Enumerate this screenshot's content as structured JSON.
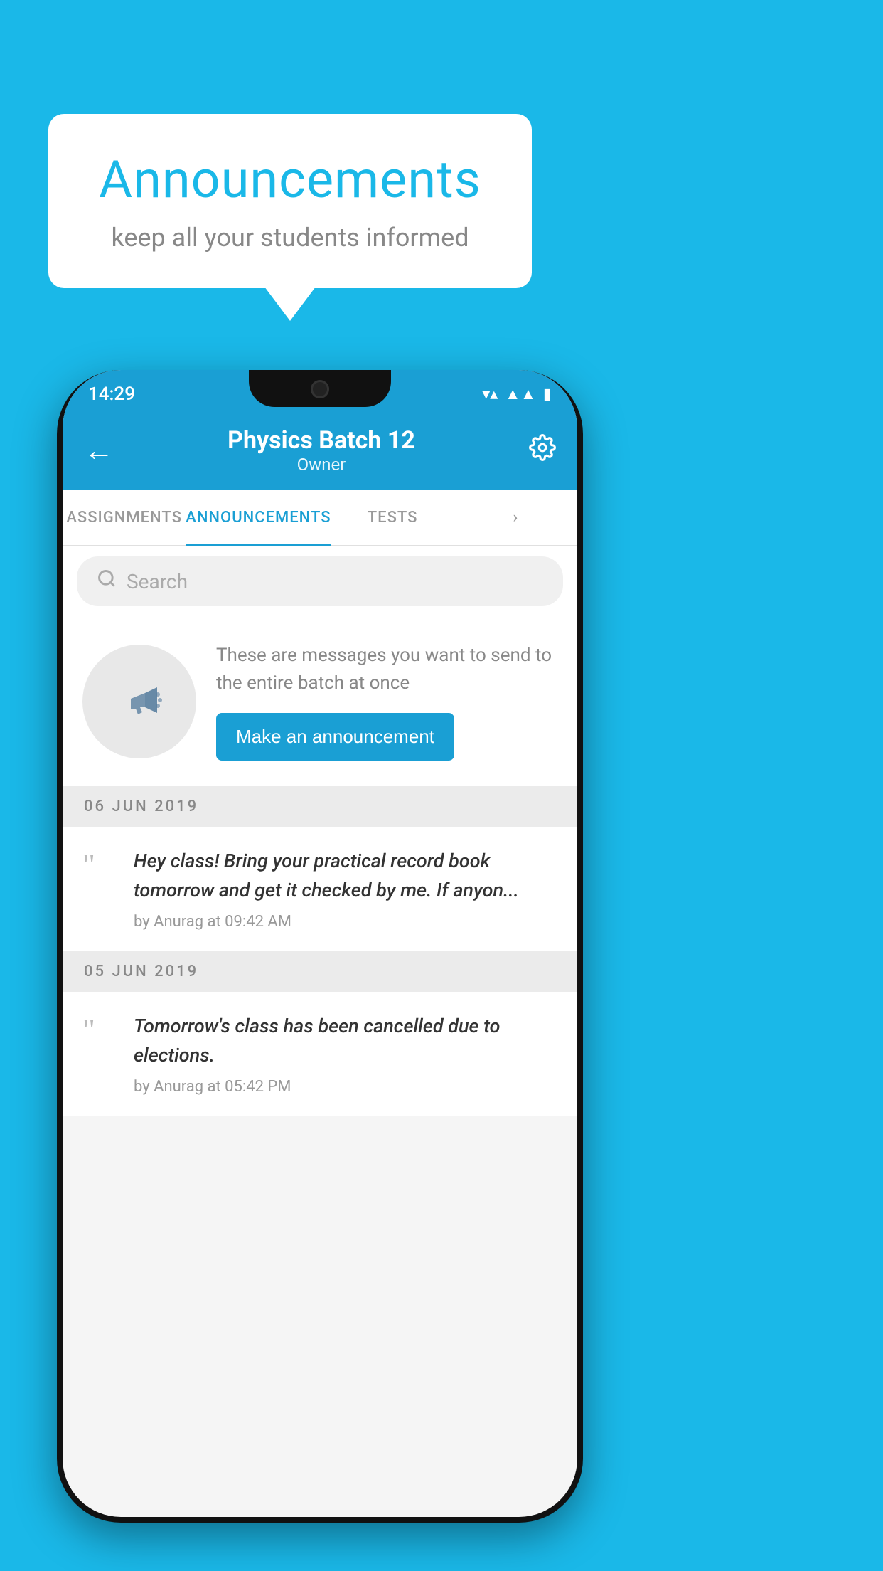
{
  "background_color": "#1ab8e8",
  "speech_bubble": {
    "title": "Announcements",
    "subtitle": "keep all your students informed"
  },
  "phone": {
    "status_bar": {
      "time": "14:29"
    },
    "app_bar": {
      "title": "Physics Batch 12",
      "subtitle": "Owner",
      "back_label": "←",
      "settings_label": "⚙"
    },
    "tabs": [
      {
        "label": "ASSIGNMENTS",
        "active": false
      },
      {
        "label": "ANNOUNCEMENTS",
        "active": true
      },
      {
        "label": "TESTS",
        "active": false
      },
      {
        "label": "···",
        "active": false
      }
    ],
    "search": {
      "placeholder": "Search"
    },
    "promo_card": {
      "description": "These are messages you want to send to the entire batch at once",
      "button_label": "Make an announcement"
    },
    "announcements": [
      {
        "date": "06  JUN  2019",
        "text": "Hey class! Bring your practical record book tomorrow and get it checked by me. If anyon...",
        "meta": "by Anurag at 09:42 AM"
      },
      {
        "date": "05  JUN  2019",
        "text": "Tomorrow's class has been cancelled due to elections.",
        "meta": "by Anurag at 05:42 PM"
      }
    ]
  }
}
